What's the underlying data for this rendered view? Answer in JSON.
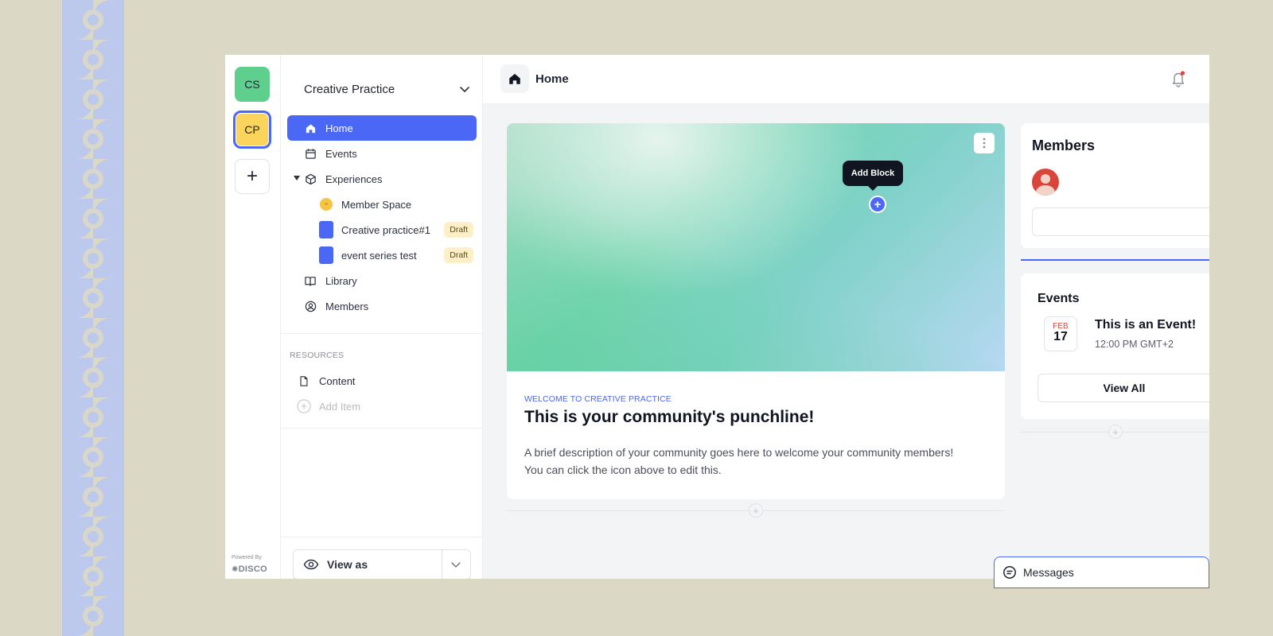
{
  "rail": {
    "communities": [
      {
        "initials": "CS",
        "color": "#5fcf8e"
      },
      {
        "initials": "CP",
        "color": "#fbd45c"
      }
    ],
    "add_label": "+",
    "powered_by": "Powered By",
    "brand": "DISCO"
  },
  "sidebar": {
    "community_name": "Creative Practice",
    "nav": [
      {
        "label": "Home",
        "icon": "home-icon",
        "active": true
      },
      {
        "label": "Events",
        "icon": "calendar-icon"
      },
      {
        "label": "Experiences",
        "icon": "cube-icon",
        "expanded": true
      },
      {
        "label": "Member Space",
        "icon": "smiley-emoji-icon"
      },
      {
        "label": "Creative practice#1",
        "icon": "blue-square-icon",
        "badge": "Draft"
      },
      {
        "label": "event series test",
        "icon": "blue-square-icon",
        "badge": "Draft"
      },
      {
        "label": "Library",
        "icon": "book-icon"
      },
      {
        "label": "Members",
        "icon": "user-circle-icon"
      }
    ],
    "resources_label": "RESOURCES",
    "resources": [
      {
        "label": "Content",
        "icon": "file-icon"
      },
      {
        "label": "Add Item",
        "icon": "plus-circle-icon"
      }
    ],
    "view_as_label": "View as"
  },
  "main": {
    "page_title": "Home",
    "hero": {
      "eyebrow": "WELCOME TO CREATIVE PRACTICE",
      "headline": "This is your community's punchline!",
      "description": "A brief description of your community goes here to welcome your community members! You can click the icon above to edit this."
    },
    "members_card": {
      "title": "Members"
    },
    "tooltip": "Add Block",
    "events_card": {
      "title": "Events",
      "event": {
        "month": "FEB",
        "day": "17",
        "title": "This is an Event!",
        "time": "12:00 PM GMT+2"
      },
      "view_all_label": "View All"
    },
    "messages_label": "Messages"
  },
  "colors": {
    "accent": "#4a67f5",
    "background": "#dbd8c6",
    "draft_badge": "#fdf0c9",
    "notification_dot": "#e0453b"
  }
}
